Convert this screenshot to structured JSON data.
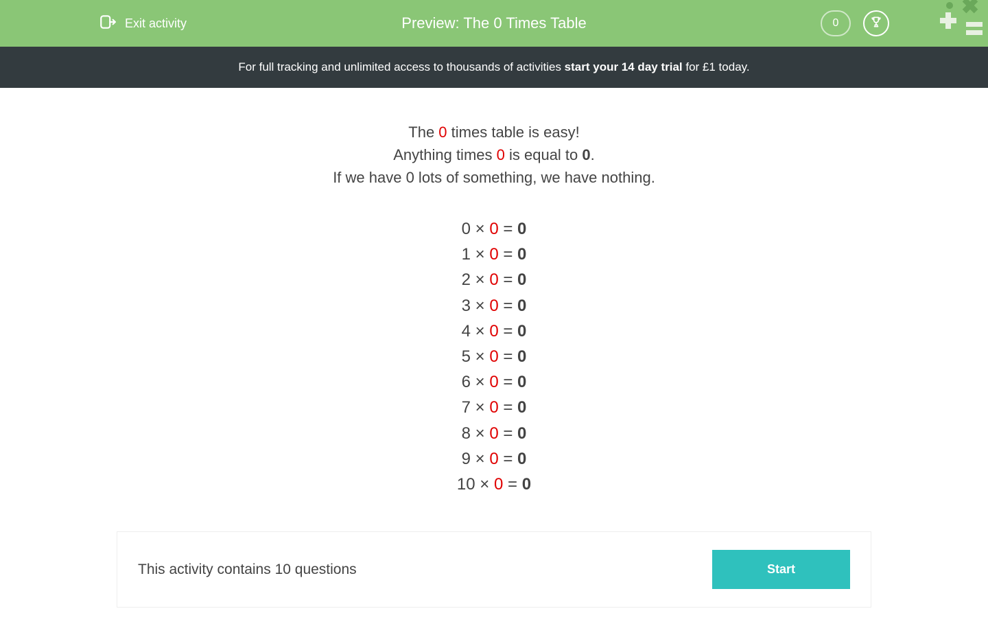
{
  "header": {
    "exit_label": "Exit activity",
    "title": "Preview: The 0 Times Table",
    "score": "0"
  },
  "promo": {
    "prefix": "For full tracking and unlimited access to thousands of activities ",
    "bold": "start your 14 day trial",
    "suffix": " for £1 today."
  },
  "intro": {
    "line1_a": "The ",
    "line1_red": "0",
    "line1_b": " times table is easy!",
    "line2_a": "Anything times ",
    "line2_red": "0",
    "line2_b": " is equal to ",
    "line2_bold": "0",
    "line2_c": ".",
    "line3": "If we have 0 lots of something, we have nothing."
  },
  "equations": [
    {
      "a": "0",
      "x": "×",
      "b": "0",
      "eq": "=",
      "r": "0"
    },
    {
      "a": "1",
      "x": "×",
      "b": "0",
      "eq": "=",
      "r": "0"
    },
    {
      "a": "2",
      "x": "×",
      "b": "0",
      "eq": "=",
      "r": "0"
    },
    {
      "a": "3",
      "x": "×",
      "b": "0",
      "eq": "=",
      "r": "0"
    },
    {
      "a": "4",
      "x": "×",
      "b": "0",
      "eq": "=",
      "r": "0"
    },
    {
      "a": "5",
      "x": "×",
      "b": "0",
      "eq": "=",
      "r": "0"
    },
    {
      "a": "6",
      "x": "×",
      "b": "0",
      "eq": "=",
      "r": "0"
    },
    {
      "a": "7",
      "x": "×",
      "b": "0",
      "eq": "=",
      "r": "0"
    },
    {
      "a": "8",
      "x": "×",
      "b": "0",
      "eq": "=",
      "r": "0"
    },
    {
      "a": "9",
      "x": "×",
      "b": "0",
      "eq": "=",
      "r": "0"
    },
    {
      "a": "10",
      "x": "×",
      "b": "0",
      "eq": "=",
      "r": "0"
    }
  ],
  "footer": {
    "text": "This activity contains 10 questions",
    "start": "Start"
  }
}
